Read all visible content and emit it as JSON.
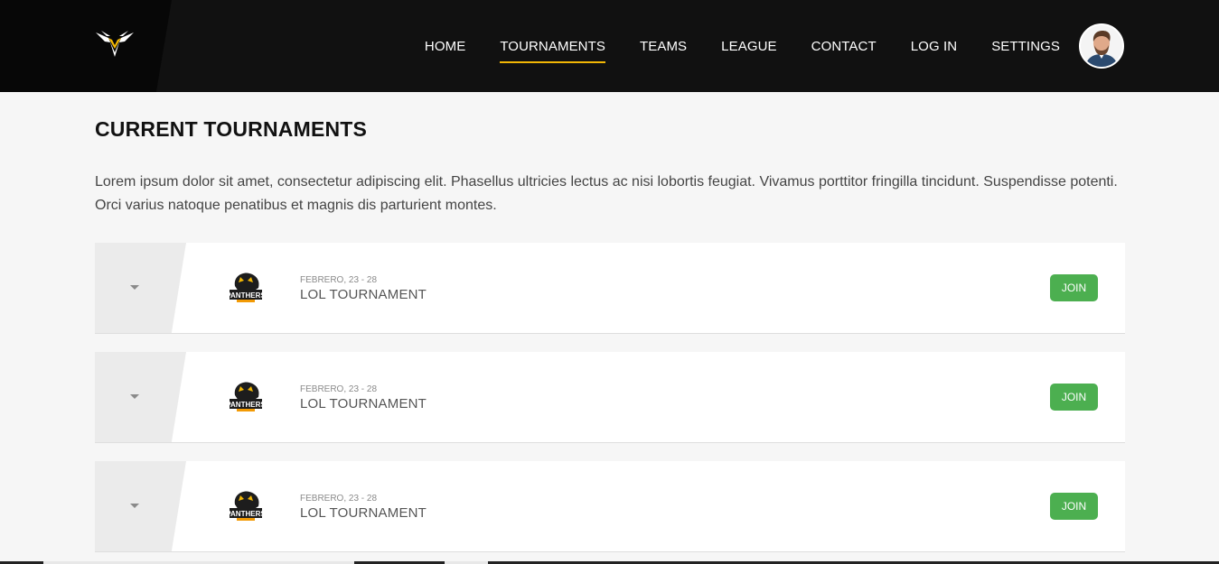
{
  "header": {
    "logo_icon": "winged-v-logo",
    "nav": [
      {
        "label": "HOME",
        "active": false
      },
      {
        "label": "TOURNAMENTS",
        "active": true
      },
      {
        "label": "TEAMS",
        "active": false
      },
      {
        "label": "LEAGUE",
        "active": false
      },
      {
        "label": "CONTACT",
        "active": false
      },
      {
        "label": "LOG IN",
        "active": false
      },
      {
        "label": "SETTINGS",
        "active": false
      }
    ],
    "avatar_icon": "user-avatar",
    "accent_color": "#f2b705"
  },
  "main": {
    "title": "CURRENT TOURNAMENTS",
    "description": "Lorem ipsum dolor sit amet, consectetur adipiscing elit. Phasellus ultricies lectus ac nisi lobortis feugiat. Vivamus porttitor fringilla tincidunt. Suspendisse potenti. Orci varius natoque penatibus et magnis dis parturient montes.",
    "tournaments": [
      {
        "date": "FEBRERO, 23 - 28",
        "name": "LOL TOURNAMENT",
        "team_logo": "panthers-logo",
        "join_label": "JOIN"
      },
      {
        "date": "FEBRERO, 23 - 28",
        "name": "LOL TOURNAMENT",
        "team_logo": "panthers-logo",
        "join_label": "JOIN"
      },
      {
        "date": "FEBRERO, 23 - 28",
        "name": "LOL TOURNAMENT",
        "team_logo": "panthers-logo",
        "join_label": "JOIN"
      }
    ],
    "join_color": "#4caf50"
  }
}
